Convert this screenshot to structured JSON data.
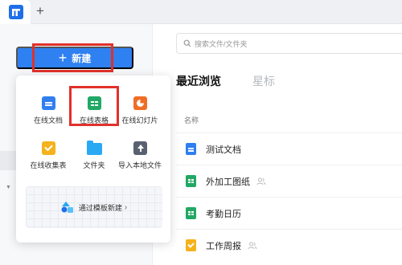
{
  "app": {
    "logo_icon": "app-logo-icon",
    "add_tab_label": "+"
  },
  "sidebar": {
    "new_button": {
      "label": "新建",
      "icon": "plus-icon",
      "color": "#2f80f0"
    }
  },
  "search": {
    "placeholder": "搜索文件/文件夹",
    "icon": "search-icon"
  },
  "main": {
    "tabs": [
      {
        "label": "最近浏览",
        "active": true
      },
      {
        "label": "星标",
        "active": false
      }
    ],
    "column_header": "名称",
    "files": [
      {
        "name": "测试文档",
        "type": "doc",
        "shared": false
      },
      {
        "name": "外加工图纸",
        "type": "sheet",
        "shared": true
      },
      {
        "name": "考勤日历",
        "type": "sheet",
        "shared": false
      },
      {
        "name": "工作周报",
        "type": "form",
        "shared": true
      }
    ]
  },
  "new_menu": {
    "items": [
      {
        "label": "在线文档",
        "icon": "online-doc-icon",
        "color": "#2f7ff0"
      },
      {
        "label": "在线表格",
        "icon": "online-sheet-icon",
        "color": "#21a865",
        "highlighted": true
      },
      {
        "label": "在线幻灯片",
        "icon": "online-slide-icon",
        "color": "#f06d27"
      },
      {
        "label": "在线收集表",
        "icon": "online-form-icon",
        "color": "#f5b21c"
      },
      {
        "label": "文件夹",
        "icon": "folder-icon",
        "color": "#2aa9f3"
      },
      {
        "label": "导入本地文件",
        "icon": "upload-icon",
        "color": "#5a6170"
      }
    ],
    "template_button": {
      "label": "通过模板新建",
      "chevron": "›"
    }
  },
  "annotations": {
    "highlight_color": "#e0312a"
  }
}
